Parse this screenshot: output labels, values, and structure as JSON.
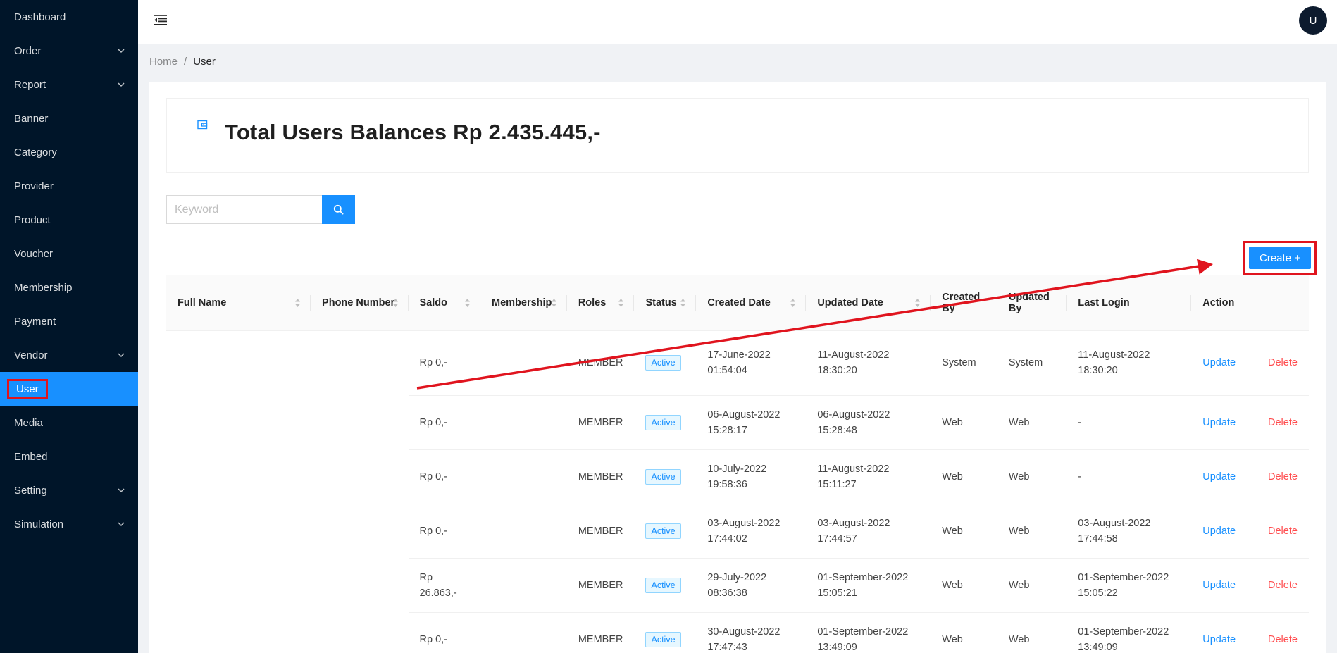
{
  "sidebar": {
    "items": [
      {
        "label": "Dashboard",
        "has_submenu": false
      },
      {
        "label": "Order",
        "has_submenu": true
      },
      {
        "label": "Report",
        "has_submenu": true
      },
      {
        "label": "Banner",
        "has_submenu": false
      },
      {
        "label": "Category",
        "has_submenu": false
      },
      {
        "label": "Provider",
        "has_submenu": false
      },
      {
        "label": "Product",
        "has_submenu": false
      },
      {
        "label": "Voucher",
        "has_submenu": false
      },
      {
        "label": "Membership",
        "has_submenu": false
      },
      {
        "label": "Payment",
        "has_submenu": false
      },
      {
        "label": "Vendor",
        "has_submenu": true
      },
      {
        "label": "User",
        "has_submenu": false,
        "active": true
      },
      {
        "label": "Media",
        "has_submenu": false
      },
      {
        "label": "Embed",
        "has_submenu": false
      },
      {
        "label": "Setting",
        "has_submenu": true
      },
      {
        "label": "Simulation",
        "has_submenu": true
      }
    ]
  },
  "header": {
    "menu_icon": "menu-fold-icon",
    "avatar_initial": "U"
  },
  "breadcrumb": {
    "home": "Home",
    "separator": "/",
    "current": "User"
  },
  "balance": {
    "icon": "wallet-icon",
    "title": "Total Users Balances Rp 2.435.445,-"
  },
  "search": {
    "placeholder": "Keyword",
    "value": "",
    "icon": "search-icon"
  },
  "create_button": {
    "label": "Create +"
  },
  "table": {
    "columns": [
      "Full Name",
      "Phone Number",
      "Saldo",
      "Membership",
      "Roles",
      "Status",
      "Created Date",
      "Updated Date",
      "Created By",
      "Updated By",
      "Last Login",
      "Action"
    ],
    "rows": [
      {
        "full_name": "",
        "phone": "",
        "saldo": "Rp 0,-",
        "membership": "",
        "roles": "MEMBER",
        "status": "Active",
        "created_date": "17-June-2022",
        "created_time": "01:54:04",
        "updated_date": "11-August-2022",
        "updated_time": "18:30:20",
        "created_by": "System",
        "updated_by": "System",
        "last_login_date": "11-August-2022",
        "last_login_time": "18:30:20",
        "update": "Update",
        "delete": "Delete"
      },
      {
        "full_name": "",
        "phone": "",
        "saldo": "Rp 0,-",
        "membership": "",
        "roles": "MEMBER",
        "status": "Active",
        "created_date": "06-August-2022",
        "created_time": "15:28:17",
        "updated_date": "06-August-2022",
        "updated_time": "15:28:48",
        "created_by": "Web",
        "updated_by": "Web",
        "last_login_date": "-",
        "last_login_time": "",
        "update": "Update",
        "delete": "Delete"
      },
      {
        "full_name": "",
        "phone": "",
        "saldo": "Rp 0,-",
        "membership": "",
        "roles": "MEMBER",
        "status": "Active",
        "created_date": "10-July-2022",
        "created_time": "19:58:36",
        "updated_date": "11-August-2022",
        "updated_time": "15:11:27",
        "created_by": "Web",
        "updated_by": "Web",
        "last_login_date": "-",
        "last_login_time": "",
        "update": "Update",
        "delete": "Delete"
      },
      {
        "full_name": "",
        "phone": "",
        "saldo": "Rp 0,-",
        "membership": "",
        "roles": "MEMBER",
        "status": "Active",
        "created_date": "03-August-2022",
        "created_time": "17:44:02",
        "updated_date": "03-August-2022",
        "updated_time": "17:44:57",
        "created_by": "Web",
        "updated_by": "Web",
        "last_login_date": "03-August-2022",
        "last_login_time": "17:44:58",
        "update": "Update",
        "delete": "Delete"
      },
      {
        "full_name": "",
        "phone": "",
        "saldo": "Rp 26.863,-",
        "membership": "",
        "roles": "MEMBER",
        "status": "Active",
        "created_date": "29-July-2022",
        "created_time": "08:36:38",
        "updated_date": "01-September-2022",
        "updated_time": "15:05:21",
        "created_by": "Web",
        "updated_by": "Web",
        "last_login_date": "01-September-2022",
        "last_login_time": "15:05:22",
        "update": "Update",
        "delete": "Delete"
      },
      {
        "full_name": "",
        "phone": "",
        "saldo": "Rp 0,-",
        "membership": "",
        "roles": "MEMBER",
        "status": "Active",
        "created_date": "30-August-2022",
        "created_time": "17:47:43",
        "updated_date": "01-September-2022",
        "updated_time": "13:49:09",
        "created_by": "Web",
        "updated_by": "Web",
        "last_login_date": "01-September-2022",
        "last_login_time": "13:49:09",
        "update": "Update",
        "delete": "Delete"
      }
    ]
  },
  "colors": {
    "sidebar_bg": "#001529",
    "primary": "#1890ff",
    "danger": "#ff4d4f",
    "annotation": "#e0141e"
  }
}
